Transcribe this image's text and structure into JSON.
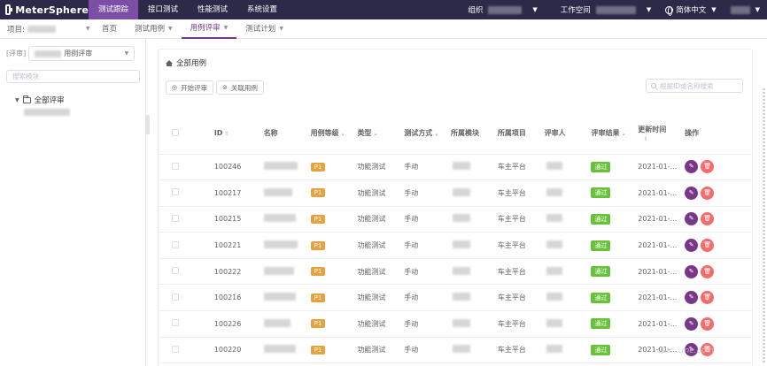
{
  "brand": {
    "name": "MeterSphere"
  },
  "topnav": [
    "测试跟踪",
    "接口测试",
    "性能测试",
    "系统设置"
  ],
  "topright": {
    "org_label": "组织",
    "workspace_label": "工作空间",
    "language": "简体中文"
  },
  "subbar": {
    "project_label": "项目:",
    "tabs": [
      "首页",
      "测试用例",
      "用例评审",
      "测试计划"
    ]
  },
  "left": {
    "review_prefix": "[评审]",
    "review_name": "用例评审",
    "search_placeholder": "搜索模块",
    "tree_root": "全部评审"
  },
  "main": {
    "breadcrumb": "全部用例",
    "start_review_btn": "开始评审",
    "link_case_btn": "关联用例",
    "search_placeholder": "根据ID或名称搜索"
  },
  "table": {
    "headers": [
      "ID",
      "名称",
      "用例等级",
      "类型",
      "测试方式",
      "所属模块",
      "所属项目",
      "评审人",
      "评审结果",
      "更新时间",
      "操作"
    ],
    "rows": [
      {
        "id": "100246",
        "level": "P1",
        "type": "功能测试",
        "method": "手动",
        "project": "车主平台",
        "result": "通过",
        "updated": "2021-01-..."
      },
      {
        "id": "100217",
        "level": "P1",
        "type": "功能测试",
        "method": "手动",
        "project": "车主平台",
        "result": "通过",
        "updated": "2021-01-..."
      },
      {
        "id": "100215",
        "level": "P1",
        "type": "功能测试",
        "method": "手动",
        "project": "车主平台",
        "result": "通过",
        "updated": "2021-01-..."
      },
      {
        "id": "100221",
        "level": "P1",
        "type": "功能测试",
        "method": "手动",
        "project": "车主平台",
        "result": "通过",
        "updated": "2021-01-..."
      },
      {
        "id": "100222",
        "level": "P1",
        "type": "功能测试",
        "method": "手动",
        "project": "车主平台",
        "result": "通过",
        "updated": "2021-01-..."
      },
      {
        "id": "100216",
        "level": "P1",
        "type": "功能测试",
        "method": "手动",
        "project": "车主平台",
        "result": "通过",
        "updated": "2021-01-..."
      },
      {
        "id": "100226",
        "level": "P1",
        "type": "功能测试",
        "method": "手动",
        "project": "车主平台",
        "result": "通过",
        "updated": "2021-01-..."
      },
      {
        "id": "100220",
        "level": "P1",
        "type": "功能测试",
        "method": "手动",
        "project": "车主平台",
        "result": "通过",
        "updated": "2021-01-..."
      }
    ]
  },
  "colors": {
    "topbar": "#2c2a48",
    "accent": "#783887",
    "p1": "#e6a23c",
    "pass": "#67c23a",
    "danger": "#f56c6c"
  },
  "icons": {
    "edit": "pencil-icon",
    "delete": "trash-icon",
    "home": "home-icon",
    "search": "search-icon"
  }
}
